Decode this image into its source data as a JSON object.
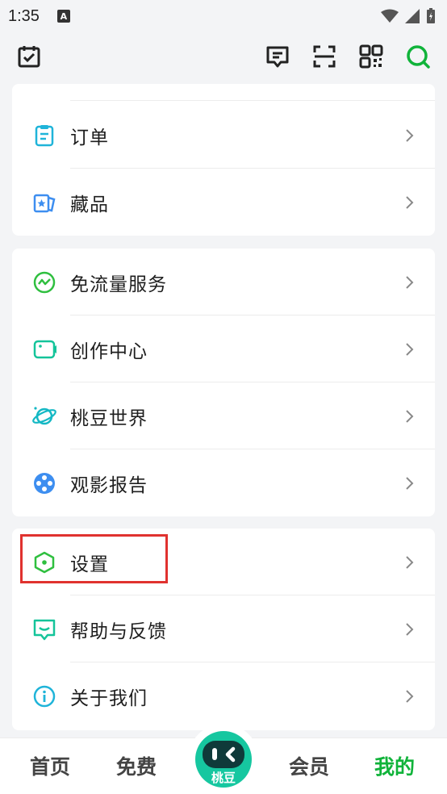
{
  "status_bar": {
    "time": "1:35",
    "notification_badge": "A"
  },
  "toolbar": {
    "left_icon": "calendar-check-icon",
    "right_icons": [
      "message-icon",
      "scan-icon",
      "qr-code-icon",
      "search-icon"
    ]
  },
  "colors": {
    "accent": "#10b33a",
    "highlight": "#e0322f",
    "teal": "#16c7a0"
  },
  "card1": {
    "items": [
      {
        "label": "订单",
        "icon": "order-clipboard-icon"
      },
      {
        "label": "藏品",
        "icon": "collection-icon"
      }
    ]
  },
  "card2": {
    "items": [
      {
        "label": "免流量服务",
        "icon": "free-data-icon"
      },
      {
        "label": "创作中心",
        "icon": "creator-center-icon"
      },
      {
        "label": "桃豆世界",
        "icon": "planet-icon"
      },
      {
        "label": "观影报告",
        "icon": "film-reel-icon"
      }
    ]
  },
  "card3": {
    "items": [
      {
        "label": "设置",
        "icon": "settings-hexagon-icon"
      },
      {
        "label": "帮助与反馈",
        "icon": "feedback-icon"
      },
      {
        "label": "关于我们",
        "icon": "info-icon"
      }
    ]
  },
  "bottom_nav": {
    "tabs": [
      {
        "label": "首页"
      },
      {
        "label": "免费"
      },
      {
        "label": "桃豆"
      },
      {
        "label": "会员"
      },
      {
        "label": "我的"
      }
    ],
    "active": "我的"
  }
}
